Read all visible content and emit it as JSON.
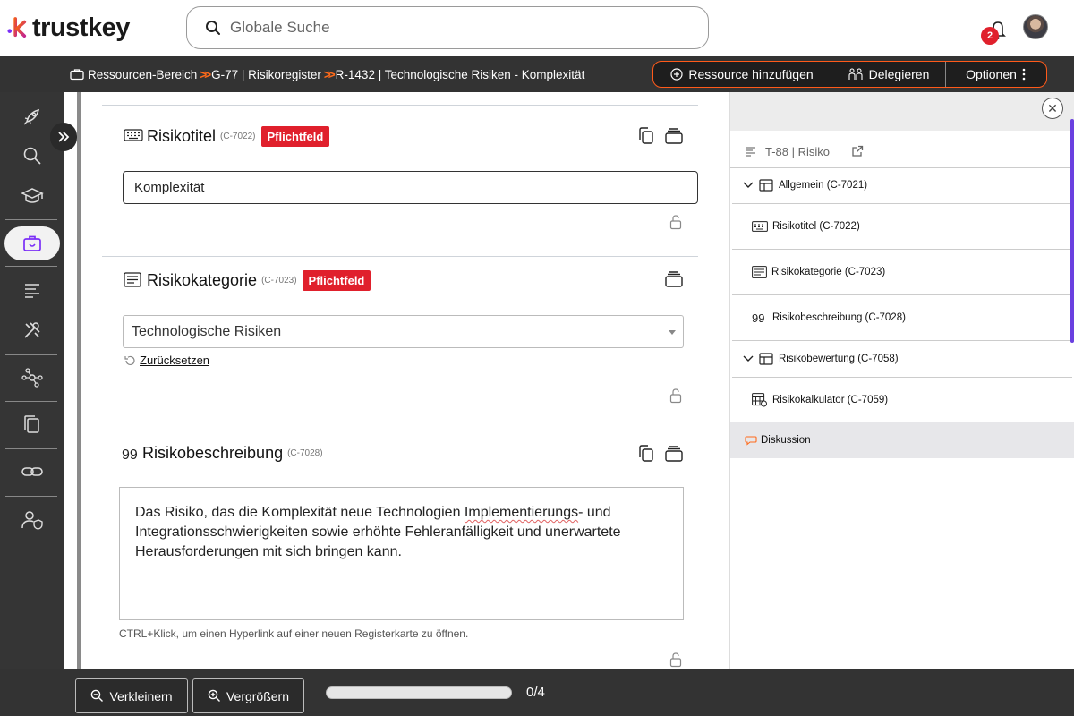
{
  "header": {
    "logo_text": "trustkey",
    "search_placeholder": "Globale Suche",
    "notifications_count": "2"
  },
  "breadcrumb": {
    "items": [
      "Ressourcen-Bereich",
      "G-77 | Risikoregister",
      "R-1432 | Technologische Risiken - Komplexität"
    ]
  },
  "actions": {
    "add_resource": "Ressource hinzufügen",
    "delegate": "Delegieren",
    "options": "Optionen"
  },
  "sidebar": {
    "items": [
      "rocket-icon",
      "search-icon",
      "graduation-cap-icon",
      "briefcase-icon",
      "list-icon",
      "tools-icon",
      "network-icon",
      "documents-icon",
      "link-icon",
      "user-shield-icon"
    ],
    "active_index": 3
  },
  "fields": {
    "title": {
      "label": "Risikotitel",
      "code": "(C-7022)",
      "badge": "Pflichtfeld",
      "value": "Komplexität"
    },
    "category": {
      "label": "Risikokategorie",
      "code": "(C-7023)",
      "badge": "Pflichtfeld",
      "value": "Technologische Risiken",
      "reset_label": "Zurücksetzen"
    },
    "description": {
      "label": "Risikobeschreibung",
      "code": "(C-7028)",
      "value_part1": "Das Risiko, das die Komplexität neue Technologien ",
      "value_misspelled": "Implementierungs",
      "value_part2": "- und Integrationsschwierigkeiten sowie erhöhte Fehleranfälligkeit und unerwartete Herausforderungen mit sich bringen kann.",
      "hint": "CTRL+Klick, um einen Hyperlink auf einer neuen Registerkarte zu öffnen."
    }
  },
  "right_panel": {
    "header": "T-88 | Risiko",
    "tree": [
      {
        "label": "Allgemein (C-7021)",
        "type": "group"
      },
      {
        "label": "Risikotitel (C-7022)",
        "type": "field"
      },
      {
        "label": "Risikokategorie (C-7023)",
        "type": "field"
      },
      {
        "label": "Risikobeschreibung (C-7028)",
        "type": "field"
      },
      {
        "label": "Risikobewertung (C-7058)",
        "type": "group"
      },
      {
        "label": "Risikokalkulator (C-7059)",
        "type": "field"
      },
      {
        "label": "Diskussion",
        "type": "discussion"
      }
    ]
  },
  "bottom": {
    "zoom_out": "Verkleinern",
    "zoom_in": "Vergrößern",
    "progress_text": "0/4",
    "progress_fraction": 0.0
  },
  "colors": {
    "accent": "#ff5a1a",
    "badge_red": "#e0202c",
    "logo_purple": "#8a2be2",
    "dark_bar": "#333333"
  }
}
